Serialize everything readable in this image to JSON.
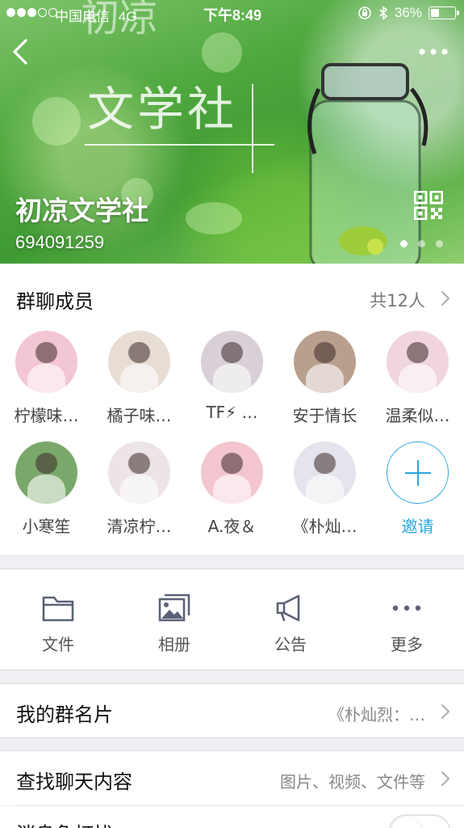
{
  "status_bar": {
    "carrier": "中国电信",
    "network": "4G",
    "time": "下午8:49",
    "battery": "36%",
    "battery_level": 0.36
  },
  "header": {
    "group_name": "初凉文学社",
    "group_id": "694091259",
    "page_indicator": {
      "count": 3,
      "active": 0
    },
    "icons": {
      "back": "back-chevron-icon",
      "more": "more-dots-icon",
      "qr": "qr-code-icon"
    }
  },
  "members_section": {
    "title": "群聊成员",
    "count": "共12人",
    "members": [
      {
        "name": "柠檬味…",
        "color": "#f3c6d3"
      },
      {
        "name": "橘子味…",
        "color": "#e8ddd4"
      },
      {
        "name": "TF⚡ …",
        "color": "#d8d0d6"
      },
      {
        "name": "安于情长",
        "color": "#b9a08e"
      },
      {
        "name": "温柔似…",
        "color": "#f0d5de"
      },
      {
        "name": "小寒笙",
        "color": "#7aa86a"
      },
      {
        "name": "清凉柠…",
        "color": "#ece4e6"
      },
      {
        "name": "A.夜＆",
        "color": "#f2c5cf"
      },
      {
        "name": "《朴灿…",
        "color": "#e4e4ec"
      }
    ],
    "invite_label": "邀请"
  },
  "actions": [
    {
      "label": "文件",
      "icon": "folder-icon"
    },
    {
      "label": "相册",
      "icon": "photo-album-icon"
    },
    {
      "label": "公告",
      "icon": "megaphone-icon"
    },
    {
      "label": "更多",
      "icon": "more-dots-icon"
    }
  ],
  "rows": {
    "card": {
      "title": "我的群名片",
      "value": "《朴灿烈：…"
    },
    "search": {
      "title": "查找聊天内容",
      "value": "图片、视频、文件等"
    },
    "mute": {
      "title": "消息免打扰",
      "enabled": false
    }
  },
  "colors": {
    "accent": "#2aa6e0",
    "header_green": "#4fa83e"
  }
}
